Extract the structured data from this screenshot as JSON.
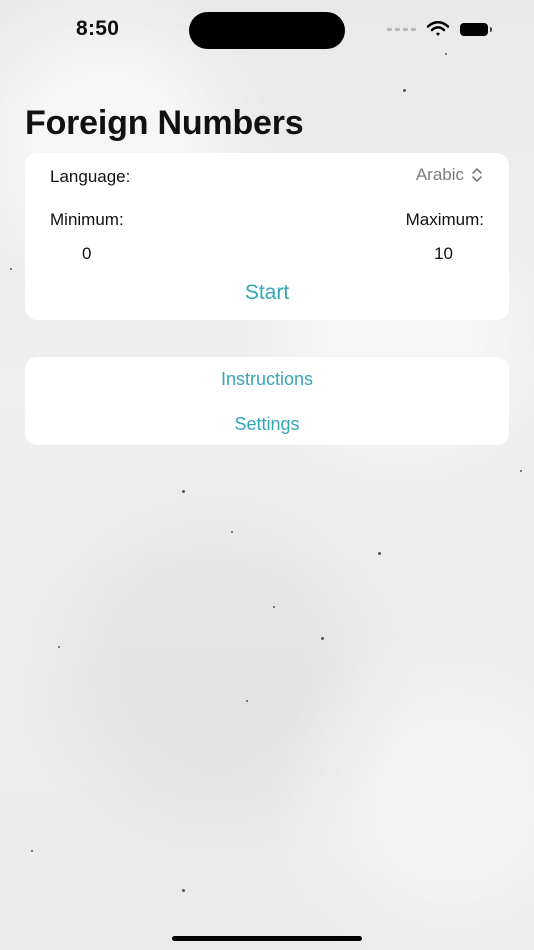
{
  "status_bar": {
    "time": "8:50",
    "icons": [
      "signal-dots-icon",
      "wifi-icon",
      "battery-icon"
    ]
  },
  "screen": {
    "title": "Foreign Numbers"
  },
  "settings_card": {
    "language_label": "Language:",
    "language_value": "Arabic",
    "minimum_label": "Minimum:",
    "maximum_label": "Maximum:",
    "minimum_value": "0",
    "maximum_value": "10",
    "start_label": "Start"
  },
  "menu_card": {
    "items": [
      {
        "label": "Instructions"
      },
      {
        "label": "Settings"
      }
    ]
  },
  "colors": {
    "accent": "#33a7b4",
    "background": "#ececec",
    "card": "#ffffff",
    "text": "#111111",
    "secondary_text": "#7d7d7d"
  }
}
